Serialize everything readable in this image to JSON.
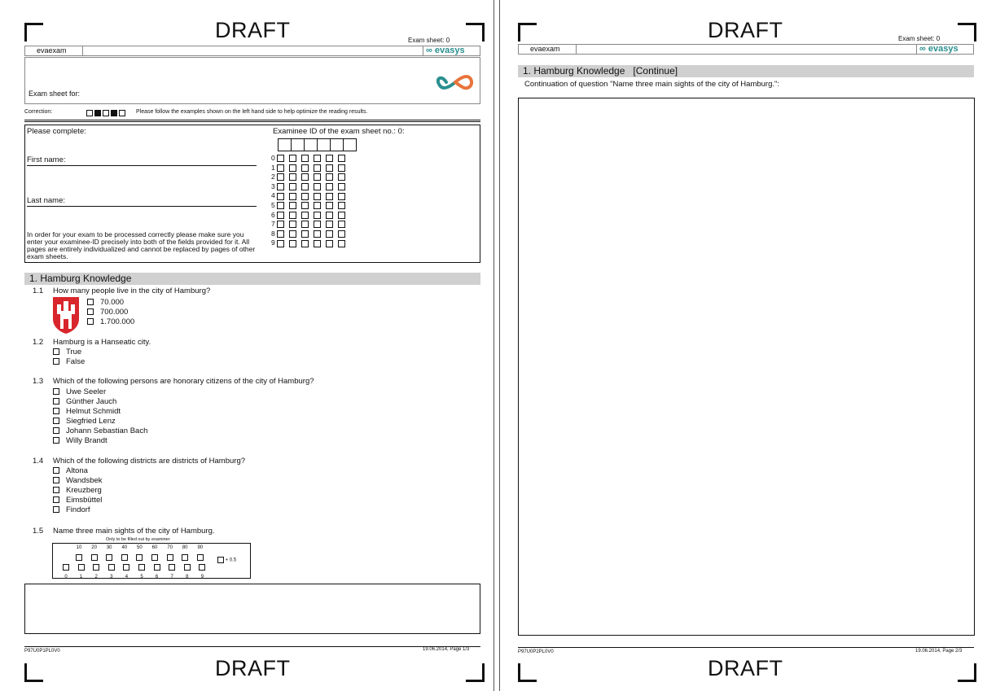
{
  "page1": {
    "draft_top": "DRAFT",
    "draft_bottom": "DRAFT",
    "exam_sheet_label": "Exam sheet: 0",
    "brand_short": "evaexam",
    "brand_logo_text": "evasys",
    "exam_sheet_for": "Exam sheet for:",
    "correction_label": "Correction:",
    "correction_note": "Please follow the examples shown on the left hand side to help optimize the reading results.",
    "please_complete": "Please complete:",
    "first_name": "First name:",
    "last_name": "Last name:",
    "instructions": "In order for your exam to be processed correctly please make sure you enter your examinee-ID precisely into both of the fields provided for it. All pages are entirely individualized and cannot be replaced by pages of other exam sheets.",
    "examinee_id_label": "Examinee ID of the exam sheet no.: 0:",
    "digits": [
      "0",
      "1",
      "2",
      "3",
      "4",
      "5",
      "6",
      "7",
      "8",
      "9"
    ],
    "section_title": "1. Hamburg Knowledge",
    "questions": [
      {
        "num": "1.1",
        "text": "How many people live in the city of Hamburg?",
        "options": [
          "70.000",
          "700.000",
          "1.700.000"
        ]
      },
      {
        "num": "1.2",
        "text": "Hamburg is a Hanseatic city.",
        "options": [
          "True",
          "False"
        ]
      },
      {
        "num": "1.3",
        "text": "Which of the following persons are honorary citizens of the city of Hamburg?",
        "options": [
          "Uwe Seeler",
          "Günther Jauch",
          "Helmut Schmidt",
          "Siegfried Lenz",
          "Johann Sebastian Bach",
          "Willy Brandt"
        ]
      },
      {
        "num": "1.4",
        "text": "Which of the following districts are districts of Hamburg?",
        "options": [
          "Altona",
          "Wandsbek",
          "Kreuzberg",
          "Eimsbüttel",
          "Findorf"
        ]
      },
      {
        "num": "1.5",
        "text": "Name three main sights of the city of Hamburg."
      }
    ],
    "examiner_only": "Only to be filled out by examiner",
    "tens": [
      "10",
      "20",
      "30",
      "40",
      "50",
      "60",
      "70",
      "80",
      "90"
    ],
    "ones": [
      "0",
      "1",
      "2",
      "3",
      "4",
      "5",
      "6",
      "7",
      "8",
      "9"
    ],
    "half_point": "+ 0.5",
    "footer_code": "P97U0P1PL0V0",
    "footer_date_page": "19.06.2014, Page 1/3"
  },
  "page2": {
    "draft_top": "DRAFT",
    "draft_bottom": "DRAFT",
    "exam_sheet_label": "Exam sheet: 0",
    "brand_short": "evaexam",
    "brand_logo_text": "evasys",
    "section_title": "1. Hamburg Knowledge   [Continue]",
    "continuation_text": "Continuation of question \"Name three main sights of the city of Hamburg.\":",
    "footer_code": "P97U0P2PL0V0",
    "footer_date_page": "19.06.2014, Page 2/3"
  },
  "colors": {
    "section_bar": "#d0d0d0",
    "logo_teal": "#2a8f8f",
    "logo_orange": "#e8743b",
    "crest_red": "#d8262c"
  }
}
